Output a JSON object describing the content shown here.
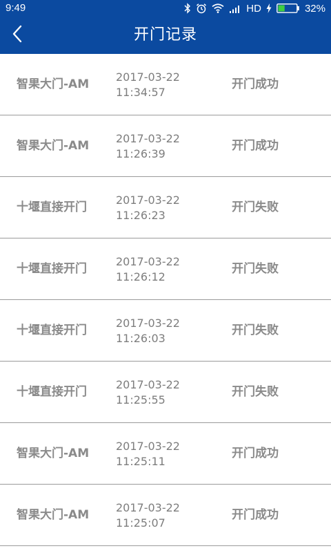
{
  "status_bar": {
    "time": "9:49",
    "network": "HD",
    "battery": "32%",
    "icons": [
      "bluetooth-icon",
      "alarm-icon",
      "wifi-icon",
      "signal-icon",
      "charging-icon",
      "battery-icon"
    ]
  },
  "header": {
    "title": "开门记录",
    "back_icon": "chevron-left-icon"
  },
  "colors": {
    "primary": "#0b4aa0",
    "text": "#8a8a8a",
    "divider": "#9a9a9a",
    "background": "#ffffff"
  },
  "records": [
    {
      "name": "智果大门-AM",
      "date": "2017-03-22",
      "time": "11:34:57",
      "status": "开门成功"
    },
    {
      "name": "智果大门-AM",
      "date": "2017-03-22",
      "time": "11:26:39",
      "status": "开门成功"
    },
    {
      "name": "十堰直接开门",
      "date": "2017-03-22",
      "time": "11:26:23",
      "status": "开门失败"
    },
    {
      "name": "十堰直接开门",
      "date": "2017-03-22",
      "time": "11:26:12",
      "status": "开门失败"
    },
    {
      "name": "十堰直接开门",
      "date": "2017-03-22",
      "time": "11:26:03",
      "status": "开门失败"
    },
    {
      "name": "十堰直接开门",
      "date": "2017-03-22",
      "time": "11:25:55",
      "status": "开门失败"
    },
    {
      "name": "智果大门-AM",
      "date": "2017-03-22",
      "time": "11:25:11",
      "status": "开门成功"
    },
    {
      "name": "智果大门-AM",
      "date": "2017-03-22",
      "time": "11:25:07",
      "status": "开门成功"
    }
  ]
}
